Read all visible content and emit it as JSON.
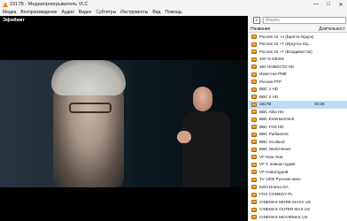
{
  "window": {
    "title": "1917B - Медиапроигрыватель VLC",
    "icon": "vlc-cone-icon",
    "controls": {
      "minimize": "—",
      "maximize": "□",
      "close": "✕"
    }
  },
  "menu": [
    "Медиа",
    "Воспроизведение",
    "Аудио",
    "Видео",
    "Субтитры",
    "Инструменты",
    "Вид",
    "Помощь"
  ],
  "video": {
    "channel_label": "Эфиймкт"
  },
  "playlist": {
    "search_placeholder": "Искать",
    "search_icon": "playlist-search-icon",
    "columns": {
      "title": "Название",
      "duration": "Длительност"
    },
    "items": [
      {
        "title": "Россия 24 +4 (Братск-Ордск)",
        "duration": ""
      },
      {
        "title": "Россия 24 +7 (Иркутск-Ор...",
        "duration": ""
      },
      {
        "title": "Россия 24 +7 (Владивосток)",
        "duration": ""
      },
      {
        "title": "100 % NEWS",
        "duration": ""
      },
      {
        "title": "360 НОВОСТИ HD",
        "duration": ""
      },
      {
        "title": "Известия РМЕ",
        "duration": ""
      },
      {
        "title": "Россия РТР",
        "duration": ""
      },
      {
        "title": "BBC 1 HD",
        "duration": ""
      },
      {
        "title": "BBC 2 HD",
        "duration": ""
      },
      {
        "title": "1917B",
        "duration": "00:25"
      },
      {
        "title": "BBC Alba HD",
        "duration": ""
      },
      {
        "title": "BBC Entertainment",
        "duration": ""
      },
      {
        "title": "BBC First HD",
        "duration": ""
      },
      {
        "title": "BBC Parliament",
        "duration": ""
      },
      {
        "title": "BBC Scotland",
        "duration": ""
      },
      {
        "title": "BBC World News",
        "duration": ""
      },
      {
        "title": "VF New Year",
        "duration": ""
      },
      {
        "title": "VF С новым годом!",
        "duration": ""
      },
      {
        "title": "VF Новогодний",
        "duration": ""
      },
      {
        "title": "TV 1000 Русское кино",
        "duration": ""
      },
      {
        "title": "beIN Drama GA",
        "duration": ""
      },
      {
        "title": "FOX COMEDY PL",
        "duration": ""
      },
      {
        "title": "CINEMAX MORE MAXX US",
        "duration": ""
      },
      {
        "title": "CINEMAX OUTER MAX US",
        "duration": ""
      },
      {
        "title": "CINEMAX MOVIEMAX US",
        "duration": ""
      }
    ],
    "active_index": 9,
    "colors": {
      "selection": "#bcdcf8",
      "item_icon": "#e38a10"
    }
  }
}
